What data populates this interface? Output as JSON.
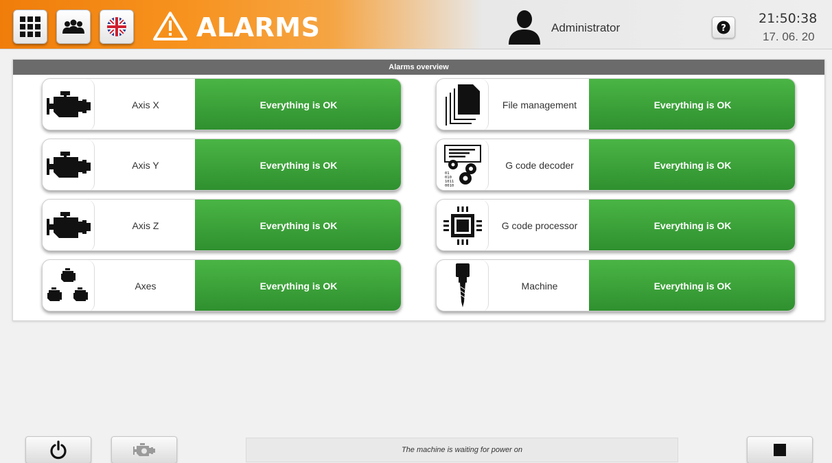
{
  "header": {
    "title": "ALARMS",
    "user": "Administrator",
    "time": "21:50:38",
    "date": "17. 06. 20",
    "buttons": [
      {
        "name": "menu-grid",
        "icon": "grid-icon"
      },
      {
        "name": "users",
        "icon": "users-icon"
      },
      {
        "name": "language",
        "icon": "uk-flag-icon"
      }
    ],
    "colors": {
      "accent": "#f7921e",
      "ok": "#3aa33a"
    }
  },
  "panel": {
    "title": "Alarms overview",
    "items": [
      {
        "label": "Axis X",
        "status": "Everything is OK",
        "icon": "engine-icon"
      },
      {
        "label": "File management",
        "status": "Everything is OK",
        "icon": "documents-icon"
      },
      {
        "label": "Axis Y",
        "status": "Everything is OK",
        "icon": "engine-icon"
      },
      {
        "label": "G code decoder",
        "status": "Everything is OK",
        "icon": "code-gears-icon"
      },
      {
        "label": "Axis Z",
        "status": "Everything is OK",
        "icon": "engine-icon"
      },
      {
        "label": "G code processor",
        "status": "Everything is OK",
        "icon": "chip-icon"
      },
      {
        "label": "Axes",
        "status": "Everything is OK",
        "icon": "engines-group-icon"
      },
      {
        "label": "Machine",
        "status": "Everything is OK",
        "icon": "spindle-icon"
      }
    ]
  },
  "footer": {
    "status_message": "The machine is waiting for power on"
  }
}
